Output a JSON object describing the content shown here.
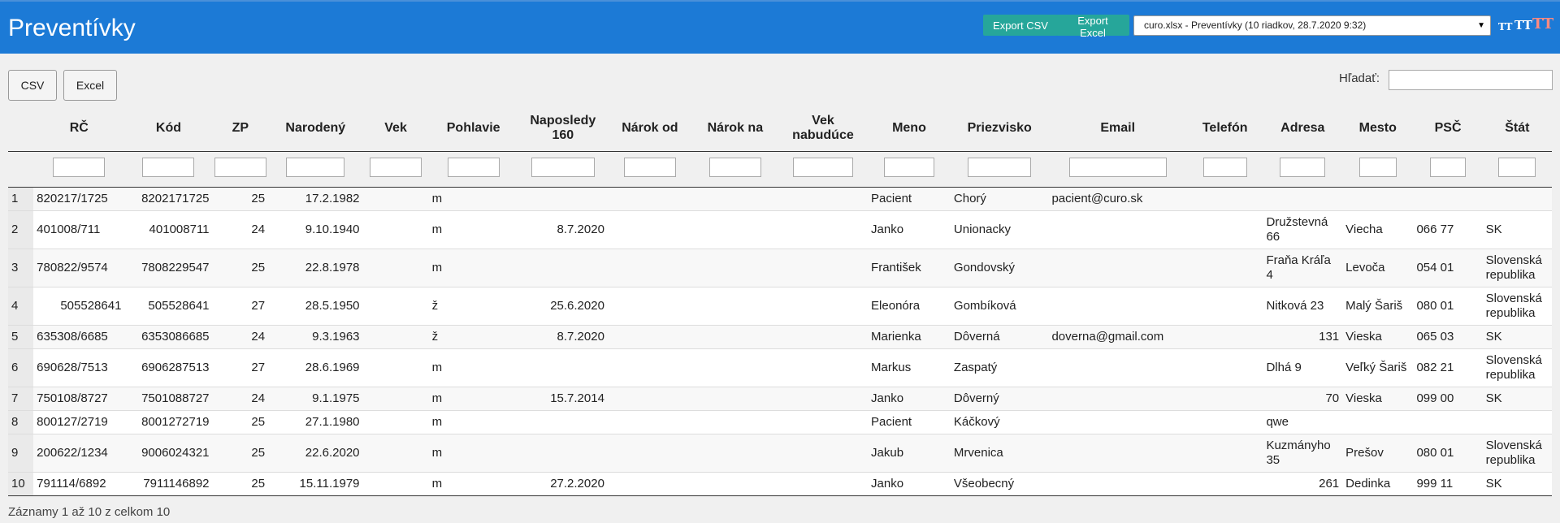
{
  "header": {
    "title": "Preventívky",
    "export_csv": "Export CSV",
    "export_excel": "Export Excel",
    "file_select": "curo.xlsx - Preventívky (10 riadkov, 28.7.2020 9:32)",
    "font_small": "TT",
    "font_medium": "TT",
    "font_large": "TT"
  },
  "toolbar": {
    "csv": "CSV",
    "excel": "Excel",
    "search_label": "Hľadať:"
  },
  "table": {
    "columns": [
      "",
      "RČ",
      "Kód",
      "ZP",
      "Narodený",
      "Vek",
      "Pohlavie",
      "Naposledy 160",
      "Nárok od",
      "Nárok na",
      "Vek nabudúce",
      "Meno",
      "Priezvisko",
      "Email",
      "Telefón",
      "Adresa",
      "Mesto",
      "PSČ",
      "Štát"
    ],
    "rows": [
      [
        "1",
        "820217/1725",
        "8202171725",
        "25",
        "17.2.1982",
        "",
        "m",
        "",
        "",
        "",
        "",
        "Pacient",
        "Chorý",
        "pacient@curo.sk",
        "",
        "",
        "",
        "",
        ""
      ],
      [
        "2",
        "401008/711",
        "401008711",
        "24",
        "9.10.1940",
        "",
        "m",
        "8.7.2020",
        "",
        "",
        "",
        "Janko",
        "Unionacky",
        "",
        "",
        "Družstevná 66",
        "Viecha",
        "066 77",
        "SK"
      ],
      [
        "3",
        "780822/9574",
        "7808229547",
        "25",
        "22.8.1978",
        "",
        "m",
        "",
        "",
        "",
        "",
        "František",
        "Gondovský",
        "",
        "",
        "Fraňa Kráľa 4",
        "Levoča",
        "054 01",
        "Slovenská republika"
      ],
      [
        "4",
        "505528641",
        "505528641",
        "27",
        "28.5.1950",
        "",
        "ž",
        "25.6.2020",
        "",
        "",
        "",
        "Eleonóra",
        "Gombíková",
        "",
        "",
        "Nitková 23",
        "Malý Šariš",
        "080 01",
        "Slovenská republika"
      ],
      [
        "5",
        "635308/6685",
        "6353086685",
        "24",
        "9.3.1963",
        "",
        "ž",
        "8.7.2020",
        "",
        "",
        "",
        "Marienka",
        "Dôverná",
        "doverna@gmail.com",
        "",
        "131",
        "Vieska",
        "065 03",
        "SK"
      ],
      [
        "6",
        "690628/7513",
        "6906287513",
        "27",
        "28.6.1969",
        "",
        "m",
        "",
        "",
        "",
        "",
        "Markus",
        "Zaspatý",
        "",
        "",
        "Dlhá 9",
        "Veľký Šariš",
        "082 21",
        "Slovenská republika"
      ],
      [
        "7",
        "750108/8727",
        "7501088727",
        "24",
        "9.1.1975",
        "",
        "m",
        "15.7.2014",
        "",
        "",
        "",
        "Janko",
        "Dôverný",
        "",
        "",
        "70",
        "Vieska",
        "099 00",
        "SK"
      ],
      [
        "8",
        "800127/2719",
        "8001272719",
        "25",
        "27.1.1980",
        "",
        "m",
        "",
        "",
        "",
        "",
        "Pacient",
        "Káčkový",
        "",
        "",
        "qwe",
        "",
        "",
        ""
      ],
      [
        "9",
        "200622/1234",
        "9006024321",
        "25",
        "22.6.2020",
        "",
        "m",
        "",
        "",
        "",
        "",
        "Jakub",
        "Mrvenica",
        "",
        "",
        "Kuzmányho 35",
        "Prešov",
        "080 01",
        "Slovenská republika"
      ],
      [
        "10",
        "791114/6892",
        "7911146892",
        "25",
        "15.11.1979",
        "",
        "m",
        "27.2.2020",
        "",
        "",
        "",
        "Janko",
        "Všeobecný",
        "",
        "",
        "261",
        "Dedinka",
        "999 11",
        "SK"
      ]
    ]
  },
  "footer": {
    "info": "Záznamy 1 až 10 z celkom 10"
  }
}
